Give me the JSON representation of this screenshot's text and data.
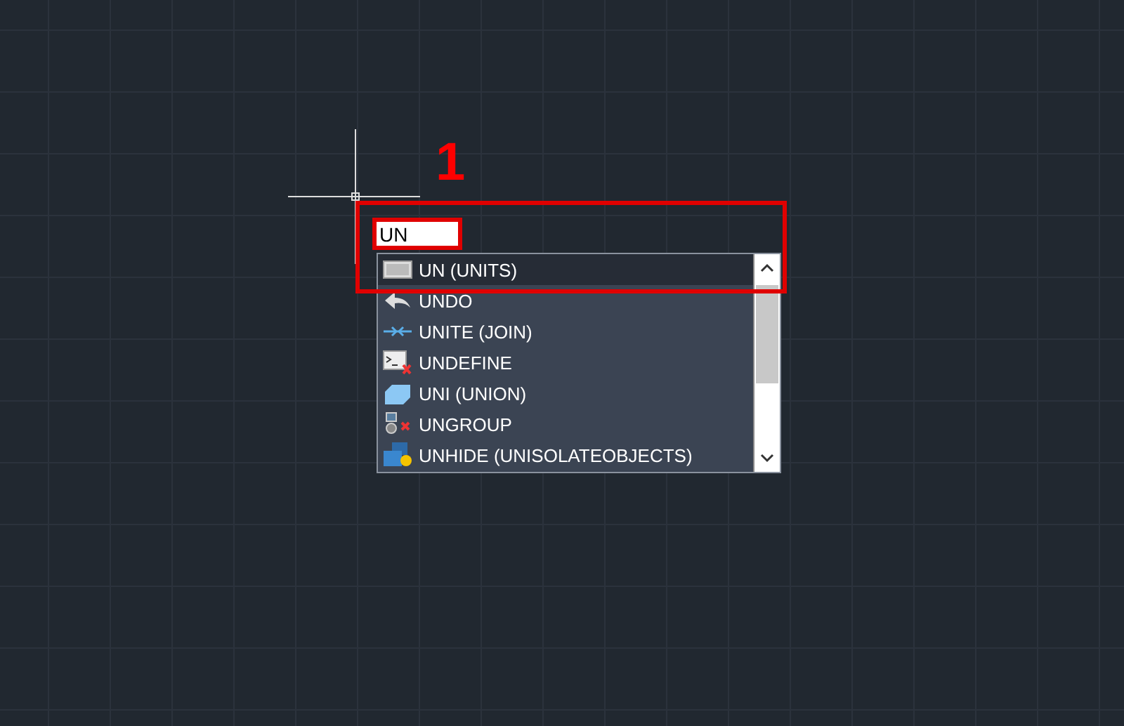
{
  "annotation": {
    "label": "1"
  },
  "command_input": {
    "value": "UN"
  },
  "suggestions": [
    {
      "label": "UN (UNITS)",
      "kind": "units",
      "selected": true
    },
    {
      "label": "UNDO",
      "kind": "undo",
      "selected": false
    },
    {
      "label": "UNITE (JOIN)",
      "kind": "join",
      "selected": false
    },
    {
      "label": "UNDEFINE",
      "kind": "undefine",
      "selected": false
    },
    {
      "label": "UNI (UNION)",
      "kind": "union",
      "selected": false
    },
    {
      "label": "UNGROUP",
      "kind": "ungroup",
      "selected": false
    },
    {
      "label": "UNHIDE (UNISOLATEOBJECTS)",
      "kind": "unhide",
      "selected": false
    }
  ]
}
